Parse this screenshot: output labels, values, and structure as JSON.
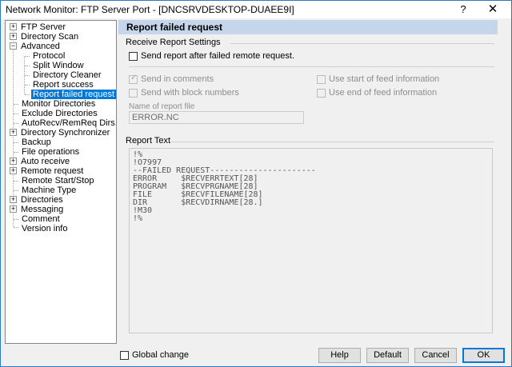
{
  "window": {
    "title": "Network Monitor: FTP Server Port - [DNCSRVDESKTOP-DUAEE9I]",
    "help_glyph": "?",
    "close_glyph": "✕"
  },
  "tree": {
    "items": [
      {
        "label": "FTP Server",
        "expander": "+"
      },
      {
        "label": "Directory Scan",
        "expander": "+"
      },
      {
        "label": "Advanced",
        "expander": "−"
      },
      {
        "label": "Protocol"
      },
      {
        "label": "Split Window"
      },
      {
        "label": "Directory Cleaner"
      },
      {
        "label": "Report success"
      },
      {
        "label": "Report failed request"
      },
      {
        "label": "Monitor Directories"
      },
      {
        "label": "Exclude Directories"
      },
      {
        "label": "AutoRecv/RemReq Dirs."
      },
      {
        "label": "Directory Synchronizer",
        "expander": "+"
      },
      {
        "label": "Backup"
      },
      {
        "label": "File operations"
      },
      {
        "label": "Auto receive",
        "expander": "+"
      },
      {
        "label": "Remote request",
        "expander": "+"
      },
      {
        "label": "Remote Start/Stop"
      },
      {
        "label": "Machine Type"
      },
      {
        "label": "Directories",
        "expander": "+"
      },
      {
        "label": "Messaging",
        "expander": "+"
      },
      {
        "label": "Comment"
      },
      {
        "label": "Version info"
      }
    ]
  },
  "panel": {
    "title": "Report failed request",
    "receive_group": "Receive Report Settings",
    "send_after_failed": "Send report after failed remote request.",
    "send_in_comments": "Send in comments",
    "send_with_block_numbers": "Send with block numbers",
    "use_start_feed": "Use start of feed information",
    "use_end_feed": "Use end of feed information",
    "report_file_label": "Name of report file",
    "report_file_value": "ERROR.NC",
    "report_text_group": "Report Text",
    "report_text": [
      "!%",
      "!O7997",
      "--FAILED REQUEST----------------------",
      "ERROR     $RECVERRTEXT[28]",
      "PROGRAM   $RECVPRGNAME[28]",
      "FILE      $RECVFILENAME[28]",
      "DIR       $RECVDIRNAME[28.]",
      "!M30",
      "!%"
    ]
  },
  "footer": {
    "global_change": "Global change",
    "help": "Help",
    "default": "Default",
    "cancel": "Cancel",
    "ok": "OK"
  }
}
